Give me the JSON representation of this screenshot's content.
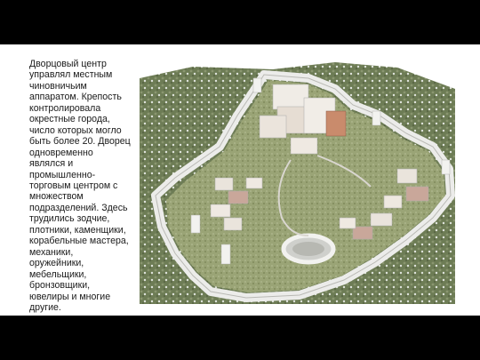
{
  "slide": {
    "caption": "Дворцовый центр\nуправлял местным\nчиновничьим\nаппаратом. Крепость\nконтролировала\nокрестные города,\nчисло которых могло\nбыть более 20. Дворец\nодновременно\nявлялся и\nпромышленно-\nторговым центром с\nмножеством\nподразделений. Здесь\nтрудились зодчие,\nплотники, каменщики,\nкорабельные мастера,\nмеханики,\nоружейники,\nмебельщики,\nбронзовщики,\nювелиры и многие\nдругие."
  },
  "colors": {
    "background": "#000000",
    "slide": "#ffffff",
    "text": "#1a1a1a",
    "rock": "#6f7f55",
    "wall": "#e8e8e4",
    "roof": "#c9a79a"
  }
}
